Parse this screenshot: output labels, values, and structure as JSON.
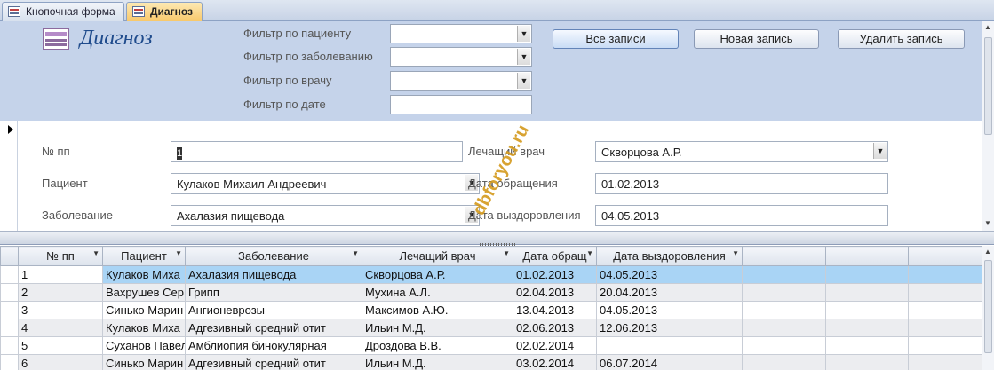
{
  "tabs": [
    {
      "label": "Кнопочная форма",
      "active": false
    },
    {
      "label": "Диагноз",
      "active": true
    }
  ],
  "header": {
    "title": "Диагноз",
    "filters": {
      "patient_label": "Фильтр по пациенту",
      "disease_label": "Фильтр по заболеванию",
      "doctor_label": "Фильтр по врачу",
      "date_label": "Фильтр по дате",
      "patient_value": "",
      "disease_value": "",
      "doctor_value": "",
      "date_value": ""
    },
    "buttons": {
      "all_records": "Все записи",
      "new_record": "Новая запись",
      "delete_record": "Удалить запись"
    }
  },
  "detail": {
    "num_label": "№ пп",
    "num_value": "1",
    "patient_label": "Пациент",
    "patient_value": "Кулаков Михаил Андреевич",
    "disease_label": "Заболевание",
    "disease_value": "Ахалазия пищевода",
    "doctor_label": "Лечащий врач",
    "doctor_value": "Скворцова А.Р.",
    "date_visit_label": "Дата обращения",
    "date_visit_value": "01.02.2013",
    "date_recovery_label": "Дата выздоровления",
    "date_recovery_value": "04.05.2013"
  },
  "watermark": "dbforyou.ru",
  "datasheet": {
    "columns": [
      "№ пп",
      "Пациент",
      "Заболевание",
      "Лечащий врач",
      "Дата обращ",
      "Дата выздоровления"
    ],
    "rows": [
      [
        "1",
        "Кулаков Миха",
        "Ахалазия пищевода",
        "Скворцова А.Р.",
        "01.02.2013",
        "04.05.2013"
      ],
      [
        "2",
        "Вахрушев Сер",
        "Грипп",
        "Мухина А.Л.",
        "02.04.2013",
        "20.04.2013"
      ],
      [
        "3",
        "Синько Марин",
        "Ангионеврозы",
        "Максимов А.Ю.",
        "13.04.2013",
        "04.05.2013"
      ],
      [
        "4",
        "Кулаков Миха",
        "Адгезивный средний отит",
        "Ильин М.Д.",
        "02.06.2013",
        "12.06.2013"
      ],
      [
        "5",
        "Суханов Павел",
        "Амблиопия бинокулярная",
        "Дроздова В.В.",
        "02.02.2014",
        ""
      ],
      [
        "6",
        "Синько Марин",
        "Адгезивный средний отит",
        "Ильин М.Д.",
        "03.02.2014",
        "06.07.2014"
      ]
    ],
    "selected_row": 0
  },
  "colors": {
    "header_bg": "#c5d3ea",
    "active_tab": "#f8c86a",
    "selected_row": "#a9d4f5",
    "title": "#1f4b8c"
  }
}
